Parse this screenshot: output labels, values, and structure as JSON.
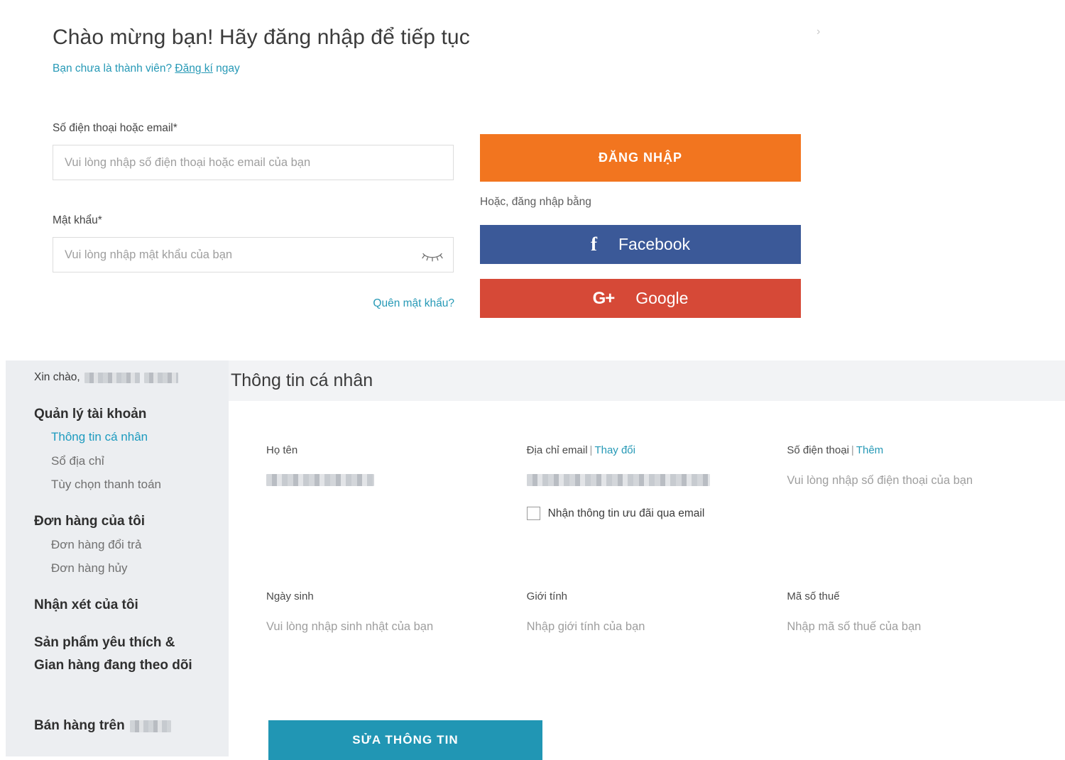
{
  "login": {
    "heading": "Chào mừng bạn! Hãy đăng nhập để tiếp tục",
    "signup_prefix": "Bạn chưa là thành viên? ",
    "signup_link": "Đăng kí",
    "signup_suffix": " ngay",
    "username_label": "Số điện thoại hoặc email*",
    "username_placeholder": "Vui lòng nhập số điện thoại hoặc email của bạn",
    "username_value": "",
    "password_label": "Mật khẩu*",
    "password_placeholder": "Vui lòng nhập mật khẩu của bạn",
    "password_value": "",
    "toggle_password_icon": "eye-off-icon",
    "forgot_password": "Quên mật khẩu?",
    "submit_label": "ĐĂNG NHẬP",
    "or_text": "Hoặc, đăng nhập bằng",
    "facebook_label": "Facebook",
    "facebook_glyph": "f",
    "google_label": "Google",
    "google_glyph": "G+",
    "corner_glyph": "›",
    "colors": {
      "primary_orange": "#F2751F",
      "facebook_blue": "#3B5998",
      "google_red": "#D64937",
      "link_teal": "#2699B6"
    }
  },
  "account": {
    "sidebar": {
      "greeting_prefix": "Xin chào,",
      "greeting_name_redacted": true,
      "groups": [
        {
          "title": "Quản lý tài khoản",
          "items": [
            {
              "label": "Thông tin cá nhân",
              "active": true
            },
            {
              "label": "Sổ địa chỉ",
              "active": false
            },
            {
              "label": "Tùy chọn thanh toán",
              "active": false
            }
          ]
        },
        {
          "title": "Đơn hàng của tôi",
          "items": [
            {
              "label": "Đơn hàng đổi trả",
              "active": false
            },
            {
              "label": "Đơn hàng hủy",
              "active": false
            }
          ]
        }
      ],
      "standalone": [
        {
          "label": "Nhận xét của tôi"
        },
        {
          "label": "Sản phẩm yêu thích & Gian hàng đang theo dõi"
        }
      ],
      "sell_label": "Bán hàng trên",
      "sell_brand_redacted": true
    },
    "panel": {
      "title": "Thông tin cá nhân",
      "fields": {
        "fullname_label": "Họ tên",
        "fullname_value_redacted": true,
        "email_label": "Địa chỉ email",
        "email_separator": "|",
        "email_action": "Thay đổi",
        "email_value_redacted": true,
        "newsletter_checkbox_label": "Nhận thông tin ưu đãi qua email",
        "newsletter_checked": false,
        "phone_label": "Số điện thoại",
        "phone_separator": "|",
        "phone_action": "Thêm",
        "phone_value": "Vui lòng nhập số điện thoại của bạn",
        "birthday_label": "Ngày sinh",
        "birthday_value": "Vui lòng nhập sinh nhật của bạn",
        "gender_label": "Giới tính",
        "gender_value": "Nhập giới tính của bạn",
        "taxcode_label": "Mã số thuế",
        "taxcode_value": "Nhập mã số thuế của bạn"
      },
      "edit_button": "SỬA THÔNG TIN",
      "colors": {
        "edit_teal": "#2196B4",
        "header_bg": "#F2F3F5",
        "sidebar_bg": "#ECEEF1"
      }
    }
  }
}
